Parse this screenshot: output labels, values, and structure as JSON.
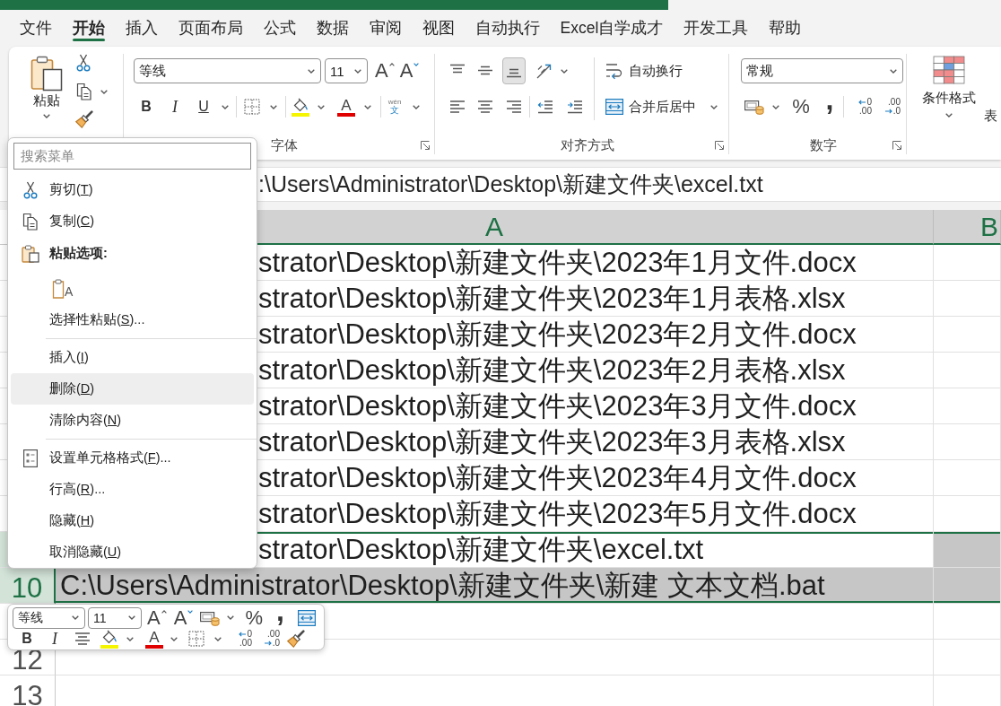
{
  "tabs": [
    {
      "label": "文件",
      "selected": false
    },
    {
      "label": "开始",
      "selected": true
    },
    {
      "label": "插入",
      "selected": false
    },
    {
      "label": "页面布局",
      "selected": false
    },
    {
      "label": "公式",
      "selected": false
    },
    {
      "label": "数据",
      "selected": false
    },
    {
      "label": "审阅",
      "selected": false
    },
    {
      "label": "视图",
      "selected": false
    },
    {
      "label": "自动执行",
      "selected": false
    },
    {
      "label": "Excel自学成才",
      "selected": false
    },
    {
      "label": "开发工具",
      "selected": false
    },
    {
      "label": "帮助",
      "selected": false
    }
  ],
  "ribbon": {
    "clipboard": {
      "paste": "粘贴"
    },
    "font": {
      "font_name": "等线",
      "font_size": "11",
      "grow_font": "A",
      "shrink_font": "A",
      "bold": "B",
      "italic": "I",
      "underline": "U",
      "font_color": "A",
      "phonetic_guide": {
        "pinyin": "wén",
        "character": "文"
      },
      "label": "字体"
    },
    "alignment": {
      "vertical": [
        {
          "selected": false
        },
        {
          "selected": false
        },
        {
          "selected": true
        }
      ],
      "wrap_text": "自动换行",
      "merge_center": "合并后居中",
      "label": "对齐方式"
    },
    "number": {
      "format": "常规",
      "percent": "%",
      "comma": ",",
      "increase_decimal": [
        "0",
        ".00"
      ],
      "decrease_decimal": [
        ".00",
        ".0"
      ],
      "label": "数字"
    },
    "styles": {
      "conditional_formatting": "条件格式",
      "format_as_table": "表"
    }
  },
  "formula_bar": {
    "value": ":\\Users\\Administrator\\Desktop\\新建文件夹\\excel.txt"
  },
  "sheet": {
    "columns": [
      {
        "label": "A",
        "selected": true
      },
      {
        "label": "B",
        "selected": true
      }
    ],
    "rows": [
      {
        "a": "strator\\Desktop\\新建文件夹\\2023年1月文件.docx",
        "selected": false,
        "active": false
      },
      {
        "a": "strator\\Desktop\\新建文件夹\\2023年1月表格.xlsx",
        "selected": false,
        "active": false
      },
      {
        "a": "strator\\Desktop\\新建文件夹\\2023年2月文件.docx",
        "selected": false,
        "active": false
      },
      {
        "a": "strator\\Desktop\\新建文件夹\\2023年2月表格.xlsx",
        "selected": false,
        "active": false
      },
      {
        "a": "strator\\Desktop\\新建文件夹\\2023年3月文件.docx",
        "selected": false,
        "active": false
      },
      {
        "a": "strator\\Desktop\\新建文件夹\\2023年3月表格.xlsx",
        "selected": false,
        "active": false
      },
      {
        "a": "strator\\Desktop\\新建文件夹\\2023年4月文件.docx",
        "selected": false,
        "active": false
      },
      {
        "a": "strator\\Desktop\\新建文件夹\\2023年5月文件.docx",
        "selected": false,
        "active": false
      },
      {
        "a": "strator\\Desktop\\新建文件夹\\excel.txt",
        "selected": true,
        "active": true
      },
      {
        "number": "10",
        "a": "C:\\Users\\Administrator\\Desktop\\新建文件夹\\新建 文本文档.bat",
        "selected": true,
        "active": false
      },
      {
        "selected": false,
        "active": false
      },
      {
        "number": "12",
        "selected": false,
        "active": false
      },
      {
        "number": "13",
        "selected": false,
        "active": false
      }
    ]
  },
  "context_menu": {
    "search": {
      "placeholder": "搜索菜单"
    },
    "items": [
      {
        "kind": "cut",
        "text": "剪切(",
        "access_key": "T",
        "after": ")",
        "hovered": false
      },
      {
        "kind": "copy",
        "text": "复制(",
        "access_key": "C",
        "after": ")",
        "hovered": false
      },
      {
        "kind": "paste_heading",
        "text": "粘贴选项:",
        "hovered": false
      },
      {
        "kind": "paste_option",
        "text": "A",
        "hovered": false
      },
      {
        "kind": "command",
        "text": "选择性粘贴(",
        "access_key": "S",
        "after": ")...",
        "hovered": false
      },
      {
        "kind": "separator"
      },
      {
        "kind": "command",
        "text": "插入(",
        "access_key": "I",
        "after": ")",
        "hovered": false
      },
      {
        "kind": "command",
        "text": "删除(",
        "access_key": "D",
        "after": ")",
        "hovered": true
      },
      {
        "kind": "command",
        "text": "清除内容(",
        "access_key": "N",
        "after": ")",
        "hovered": false
      },
      {
        "kind": "separator"
      },
      {
        "kind": "format_cells",
        "text": "设置单元格格式(",
        "access_key": "F",
        "after": ")...",
        "hovered": false
      },
      {
        "kind": "command",
        "text": "行高(",
        "access_key": "R",
        "after": ")...",
        "hovered": false
      },
      {
        "kind": "command",
        "text": "隐藏(",
        "access_key": "H",
        "after": ")",
        "hovered": false
      },
      {
        "kind": "command",
        "text": "取消隐藏(",
        "access_key": "U",
        "after": ")",
        "hovered": false
      }
    ]
  },
  "mini_toolbar": {
    "font_name": "等线",
    "font_size": "11",
    "grow_font": "A",
    "shrink_font": "A",
    "percent": "%",
    "comma": ",",
    "bold": "B",
    "italic": "I",
    "font_color": "A",
    "increase_decimal": [
      "0",
      ".00"
    ],
    "decrease_decimal": [
      ".00",
      ".0"
    ]
  }
}
